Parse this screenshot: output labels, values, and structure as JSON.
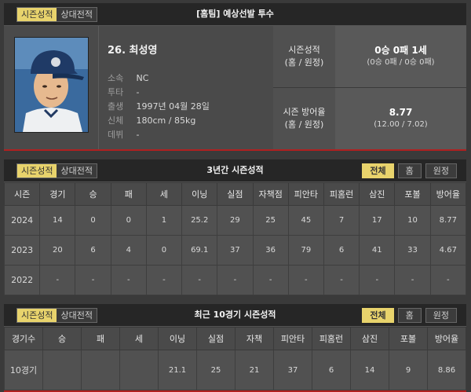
{
  "profile": {
    "tabs": [
      "시즌성적",
      "상대전적"
    ],
    "title": "[홈팀] 예상선발 투수",
    "name": "26. 최성영",
    "info": [
      {
        "label": "소속",
        "value": "NC"
      },
      {
        "label": "투타",
        "value": "-"
      },
      {
        "label": "출생",
        "value": "1997년 04월 28일"
      },
      {
        "label": "신체",
        "value": "180cm / 85kg"
      },
      {
        "label": "데뷔",
        "value": "-"
      }
    ],
    "season_record": {
      "label1": "시즌성적",
      "label2": "(홈 / 원정)",
      "main": "0승 0패 1세",
      "sub": "(0승 0패 / 0승 0패)"
    },
    "season_era": {
      "label1": "시즌 방어율",
      "label2": "(홈 / 원정)",
      "main": "8.77",
      "sub": "(12.00 / 7.02)"
    }
  },
  "season": {
    "tabs": [
      "시즌성적",
      "상대전적"
    ],
    "title": "3년간 시즌성적",
    "filters": [
      "전체",
      "홈",
      "원정"
    ],
    "headers": [
      "시즌",
      "경기",
      "승",
      "패",
      "세",
      "이닝",
      "실점",
      "자책점",
      "피안타",
      "피홈런",
      "삼진",
      "포볼",
      "방어율"
    ],
    "rows": [
      [
        "2024",
        "14",
        "0",
        "0",
        "1",
        "25.2",
        "29",
        "25",
        "45",
        "7",
        "17",
        "10",
        "8.77"
      ],
      [
        "2023",
        "20",
        "6",
        "4",
        "0",
        "69.1",
        "37",
        "36",
        "79",
        "6",
        "41",
        "33",
        "4.67"
      ],
      [
        "2022",
        "-",
        "-",
        "-",
        "-",
        "-",
        "-",
        "-",
        "-",
        "-",
        "-",
        "-",
        "-"
      ]
    ]
  },
  "recent": {
    "tabs": [
      "시즌성적",
      "상대전적"
    ],
    "title": "최근 10경기 시즌성적",
    "filters": [
      "전체",
      "홈",
      "원정"
    ],
    "headers": [
      "경기수",
      "승",
      "패",
      "세",
      "이닝",
      "실점",
      "자책",
      "피안타",
      "피홈런",
      "삼진",
      "포볼",
      "방어율"
    ],
    "rows": [
      [
        "10경기",
        "",
        "",
        "",
        "21.1",
        "25",
        "21",
        "37",
        "6",
        "14",
        "9",
        "8.86"
      ]
    ]
  }
}
